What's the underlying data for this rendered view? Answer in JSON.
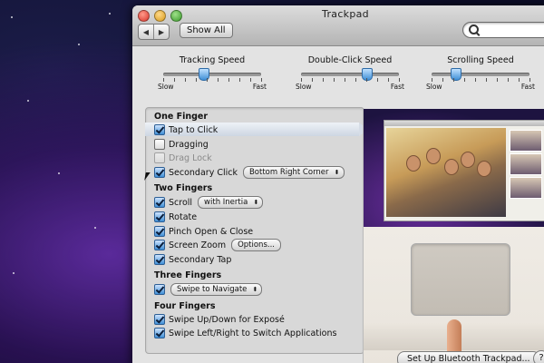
{
  "window": {
    "title": "Trackpad"
  },
  "toolbar": {
    "show_all_label": "Show All",
    "search_placeholder": ""
  },
  "sliders": [
    {
      "title": "Tracking Speed",
      "min_label": "Slow",
      "max_label": "Fast",
      "value": 0.42
    },
    {
      "title": "Double-Click Speed",
      "min_label": "Slow",
      "max_label": "Fast",
      "value": 0.68
    },
    {
      "title": "Scrolling Speed",
      "min_label": "Slow",
      "max_label": "Fast",
      "value": 0.25
    }
  ],
  "sections": {
    "one_finger": {
      "header": "One Finger",
      "tap_to_click": {
        "label": "Tap to Click",
        "checked": true
      },
      "dragging": {
        "label": "Dragging",
        "checked": false
      },
      "drag_lock": {
        "label": "Drag Lock",
        "checked": false,
        "enabled": false
      },
      "secondary_click": {
        "label": "Secondary Click",
        "checked": true,
        "popup": "Bottom Right Corner"
      }
    },
    "two_fingers": {
      "header": "Two Fingers",
      "scroll": {
        "label": "Scroll",
        "checked": true,
        "popup": "with Inertia"
      },
      "rotate": {
        "label": "Rotate",
        "checked": true
      },
      "pinch": {
        "label": "Pinch Open & Close",
        "checked": true
      },
      "screen_zoom": {
        "label": "Screen Zoom",
        "checked": true,
        "button": "Options..."
      },
      "secondary_tap": {
        "label": "Secondary Tap",
        "checked": true
      }
    },
    "three_fingers": {
      "header": "Three Fingers",
      "swipe": {
        "checked": true,
        "popup": "Swipe to Navigate"
      }
    },
    "four_fingers": {
      "header": "Four Fingers",
      "swipe_updown": {
        "label": "Swipe Up/Down for Exposé",
        "checked": true
      },
      "swipe_leftright": {
        "label": "Swipe Left/Right to Switch Applications",
        "checked": true
      }
    }
  },
  "footer": {
    "bluetooth_button": "Set Up Bluetooth Trackpad...",
    "help_button": "?"
  }
}
